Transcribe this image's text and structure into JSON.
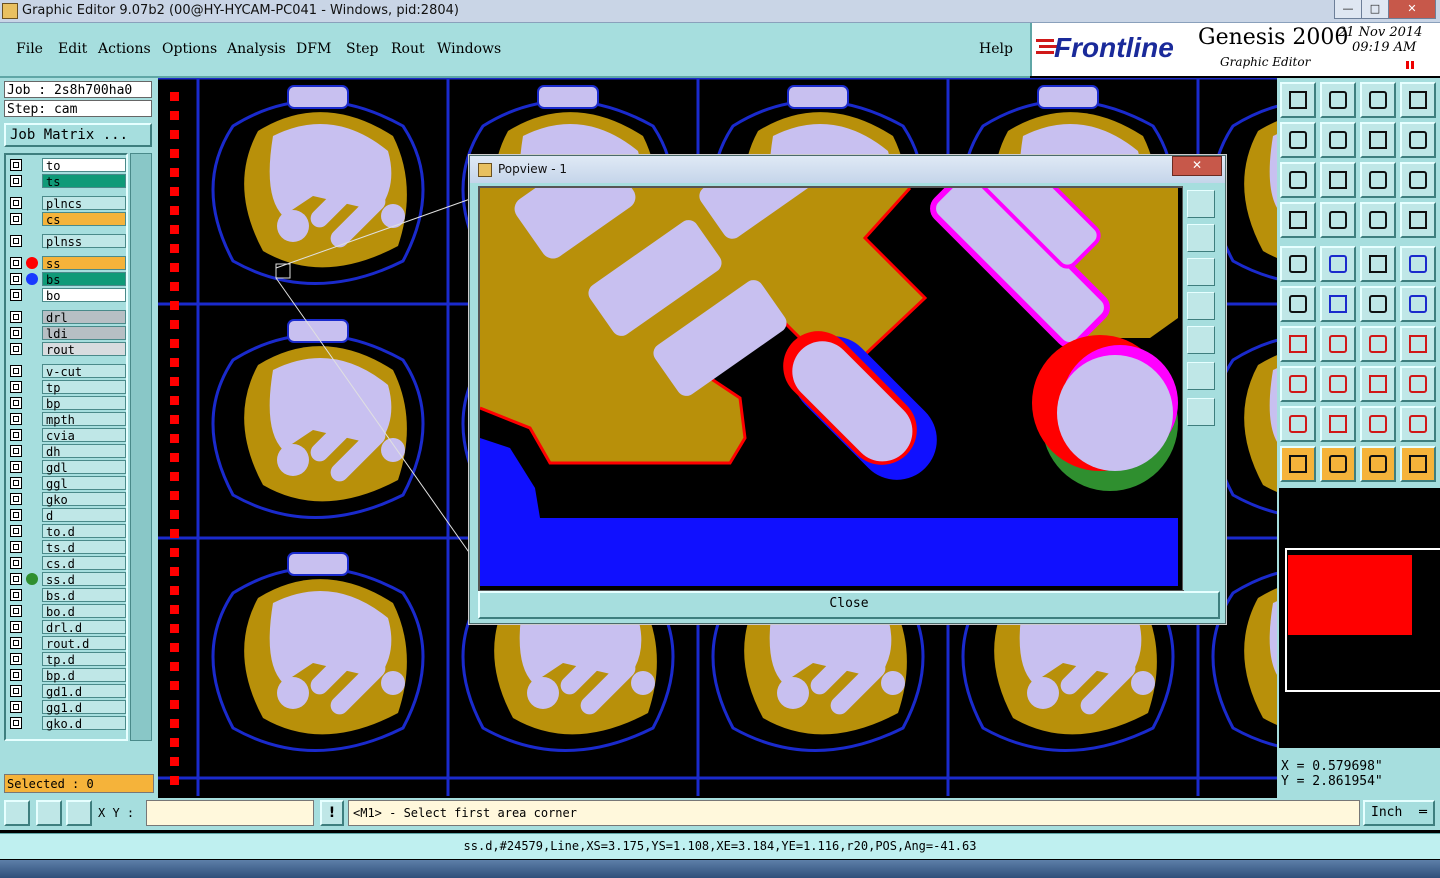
{
  "window": {
    "title": "Graphic Editor 9.07b2 (00@HY-HYCAM-PC041 - Windows, pid:2804)"
  },
  "menu": {
    "items": [
      "File",
      "Edit",
      "Actions",
      "Options",
      "Analysis",
      "DFM",
      "Step",
      "Rout",
      "Windows"
    ],
    "help": "Help"
  },
  "brand": {
    "logo": "Frontline",
    "product": "Genesis 2000",
    "subtitle": "Graphic Editor",
    "date": "21 Nov 2014",
    "time": "09:19 AM"
  },
  "job": {
    "job_line": "Job : 2s8h700ha0",
    "step_line": "Step: cam",
    "matrix_button": "Job Matrix ..."
  },
  "layers": [
    {
      "name": "to",
      "bg": "#ffffff"
    },
    {
      "name": "ts",
      "bg": "#0f9a78"
    },
    {
      "name": "plncs",
      "bg": "#bfe7e7"
    },
    {
      "name": "cs",
      "bg": "#f5b33a"
    },
    {
      "name": "plnss",
      "bg": "#bfe7e7"
    },
    {
      "name": "ss",
      "bg": "#f5b33a",
      "dot": "#ff0000"
    },
    {
      "name": "bs",
      "bg": "#0f9a78",
      "dot": "#1a3aff"
    },
    {
      "name": "bo",
      "bg": "#ffffff"
    },
    {
      "name": "drl",
      "bg": "#b7bfc4"
    },
    {
      "name": "ldi",
      "bg": "#b7bfc4"
    },
    {
      "name": "rout",
      "bg": "#d8dcdf"
    },
    {
      "name": "v-cut",
      "bg": "#bfe7e7"
    },
    {
      "name": "tp",
      "bg": "#bfe7e7"
    },
    {
      "name": "bp",
      "bg": "#bfe7e7"
    },
    {
      "name": "mpth",
      "bg": "#bfe7e7"
    },
    {
      "name": "cvia",
      "bg": "#bfe7e7"
    },
    {
      "name": "dh",
      "bg": "#bfe7e7"
    },
    {
      "name": "gdl",
      "bg": "#bfe7e7"
    },
    {
      "name": "ggl",
      "bg": "#bfe7e7"
    },
    {
      "name": "gko",
      "bg": "#bfe7e7"
    },
    {
      "name": "d",
      "bg": "#bfe7e7"
    },
    {
      "name": "to.d",
      "bg": "#bfe7e7"
    },
    {
      "name": "ts.d",
      "bg": "#bfe7e7"
    },
    {
      "name": "cs.d",
      "bg": "#bfe7e7"
    },
    {
      "name": "ss.d",
      "bg": "#bfe7e7",
      "dot": "#2f8f2f"
    },
    {
      "name": "bs.d",
      "bg": "#bfe7e7"
    },
    {
      "name": "bo.d",
      "bg": "#bfe7e7"
    },
    {
      "name": "drl.d",
      "bg": "#bfe7e7"
    },
    {
      "name": "rout.d",
      "bg": "#bfe7e7"
    },
    {
      "name": "tp.d",
      "bg": "#bfe7e7"
    },
    {
      "name": "bp.d",
      "bg": "#bfe7e7"
    },
    {
      "name": "gd1.d",
      "bg": "#bfe7e7"
    },
    {
      "name": "gg1.d",
      "bg": "#bfe7e7"
    },
    {
      "name": "gko.d",
      "bg": "#bfe7e7"
    }
  ],
  "selected": "Selected : 0",
  "popview": {
    "title": "Popview - 1",
    "close_label": "Close"
  },
  "coords": {
    "x": "X = 0.579698\"",
    "y": "Y = 2.861954\""
  },
  "command": {
    "xy_label": "X Y :",
    "prompt": "<M1> - Select first area corner",
    "unit": "Inch"
  },
  "status": "ss.d,#24579,Line,XS=3.175,YS=1.108,XE=3.184,YE=1.116,r20,POS,Ang=-41.63",
  "colors": {
    "panel": "#a6dede",
    "copper": "#b8900a",
    "pad": "#c8c0f0",
    "outline": "#1a2acc"
  }
}
